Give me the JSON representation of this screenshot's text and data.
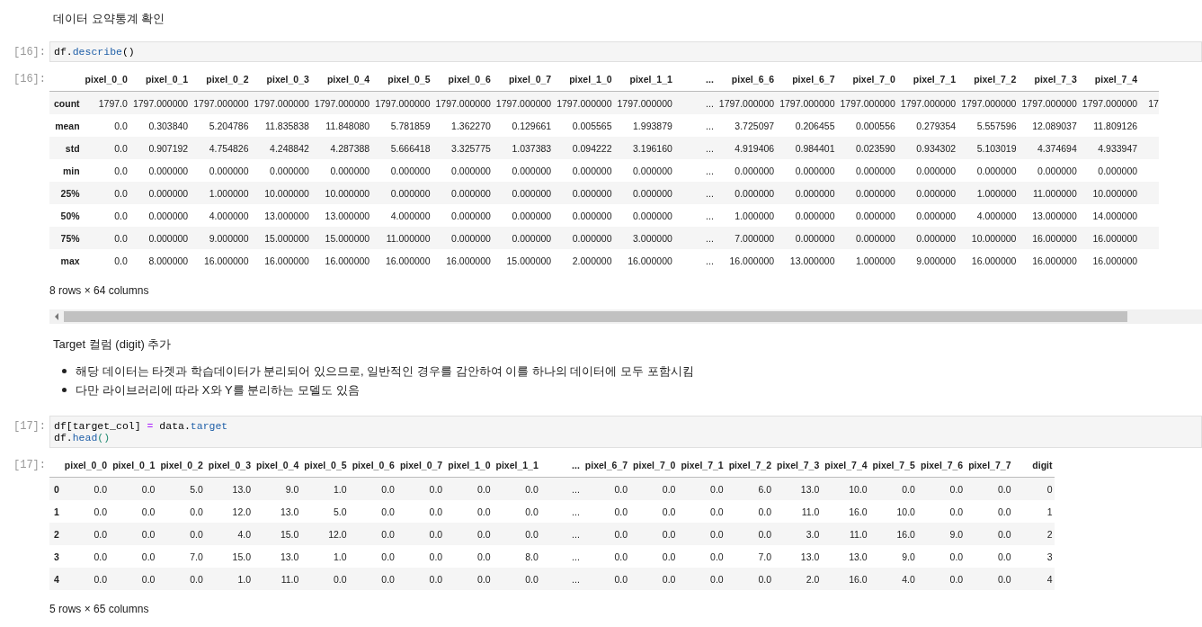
{
  "cells": [
    {
      "kind": "markdown",
      "paragraphs": [
        "데이터 요약통계 확인"
      ]
    },
    {
      "kind": "code",
      "prompt": "[16]:",
      "lines": [
        [
          {
            "text": "df.",
            "kind": "plain"
          },
          {
            "text": "describe",
            "kind": "attr"
          },
          {
            "text": "()",
            "kind": "plain"
          }
        ]
      ]
    },
    {
      "kind": "output",
      "prompt": "[16]:",
      "table": {
        "columns": [
          {
            "label": "pixel_0_0"
          },
          {
            "label": "pixel_0_1"
          },
          {
            "label": "pixel_0_2"
          },
          {
            "label": "pixel_0_3"
          },
          {
            "label": "pixel_0_4"
          },
          {
            "label": "pixel_0_5"
          },
          {
            "label": "pixel_0_6"
          },
          {
            "label": "pixel_0_7"
          },
          {
            "label": "pixel_1_0"
          },
          {
            "label": "pixel_1_1"
          },
          {
            "label": "..."
          },
          {
            "label": "pixel_6_6"
          },
          {
            "label": "pixel_6_7"
          },
          {
            "label": "pixel_7_0"
          },
          {
            "label": "pixel_7_1"
          },
          {
            "label": "pixel_7_2"
          },
          {
            "label": "pixel_7_3"
          },
          {
            "label": "pixel_7_4"
          },
          {
            "kind": "cut"
          }
        ],
        "rows": [
          {
            "index": "count",
            "cells": [
              "1797.0",
              "1797.000000",
              "1797.000000",
              "1797.000000",
              "1797.000000",
              "1797.000000",
              "1797.000000",
              "1797.000000",
              "1797.000000",
              "1797.000000",
              "...",
              "1797.000000",
              "1797.000000",
              "1797.000000",
              "1797.000000",
              "1797.000000",
              "1797.000000",
              "1797.000000",
              "17"
            ]
          },
          {
            "index": "mean",
            "cells": [
              "0.0",
              "0.303840",
              "5.204786",
              "11.835838",
              "11.848080",
              "5.781859",
              "1.362270",
              "0.129661",
              "0.005565",
              "1.993879",
              "...",
              "3.725097",
              "0.206455",
              "0.000556",
              "0.279354",
              "5.557596",
              "12.089037",
              "11.809126"
            ]
          },
          {
            "index": "std",
            "cells": [
              "0.0",
              "0.907192",
              "4.754826",
              "4.248842",
              "4.287388",
              "5.666418",
              "3.325775",
              "1.037383",
              "0.094222",
              "3.196160",
              "...",
              "4.919406",
              "0.984401",
              "0.023590",
              "0.934302",
              "5.103019",
              "4.374694",
              "4.933947"
            ]
          },
          {
            "index": "min",
            "cells": [
              "0.0",
              "0.000000",
              "0.000000",
              "0.000000",
              "0.000000",
              "0.000000",
              "0.000000",
              "0.000000",
              "0.000000",
              "0.000000",
              "...",
              "0.000000",
              "0.000000",
              "0.000000",
              "0.000000",
              "0.000000",
              "0.000000",
              "0.000000"
            ]
          },
          {
            "index": "25%",
            "cells": [
              "0.0",
              "0.000000",
              "1.000000",
              "10.000000",
              "10.000000",
              "0.000000",
              "0.000000",
              "0.000000",
              "0.000000",
              "0.000000",
              "...",
              "0.000000",
              "0.000000",
              "0.000000",
              "0.000000",
              "1.000000",
              "11.000000",
              "10.000000"
            ]
          },
          {
            "index": "50%",
            "cells": [
              "0.0",
              "0.000000",
              "4.000000",
              "13.000000",
              "13.000000",
              "4.000000",
              "0.000000",
              "0.000000",
              "0.000000",
              "0.000000",
              "...",
              "1.000000",
              "0.000000",
              "0.000000",
              "0.000000",
              "4.000000",
              "13.000000",
              "14.000000"
            ]
          },
          {
            "index": "75%",
            "cells": [
              "0.0",
              "0.000000",
              "9.000000",
              "15.000000",
              "15.000000",
              "11.000000",
              "0.000000",
              "0.000000",
              "0.000000",
              "3.000000",
              "...",
              "7.000000",
              "0.000000",
              "0.000000",
              "0.000000",
              "10.000000",
              "16.000000",
              "16.000000"
            ]
          },
          {
            "index": "max",
            "cells": [
              "0.0",
              "8.000000",
              "16.000000",
              "16.000000",
              "16.000000",
              "16.000000",
              "16.000000",
              "15.000000",
              "2.000000",
              "16.000000",
              "...",
              "16.000000",
              "13.000000",
              "1.000000",
              "9.000000",
              "16.000000",
              "16.000000",
              "16.000000"
            ]
          }
        ]
      },
      "footer": "8 rows × 64 columns",
      "scrollbar": true
    },
    {
      "kind": "markdown",
      "paragraphs": [
        "Target 컬럼 (digit) 추가"
      ],
      "bullets": [
        "해당 데이터는 타겟과 학습데이터가 분리되어 있으므로, 일반적인 경우를 감안하여 이를 하나의 데이터에 모두 포함시킴",
        "다만 라이브러리에 따라 X와 Y를 분리하는 모델도 있음"
      ]
    },
    {
      "kind": "code",
      "prompt": "[17]:",
      "lines": [
        [
          {
            "text": "df[target_col] ",
            "kind": "plain"
          },
          {
            "text": "=",
            "kind": "op"
          },
          {
            "text": " data.",
            "kind": "plain"
          },
          {
            "text": "target",
            "kind": "attr"
          }
        ],
        [
          {
            "text": "df.",
            "kind": "plain"
          },
          {
            "text": "head",
            "kind": "attr"
          },
          {
            "text": "()",
            "kind": "paren"
          }
        ]
      ]
    },
    {
      "kind": "output",
      "prompt": "[17]:",
      "table": {
        "columns": [
          {
            "label": "pixel_0_0"
          },
          {
            "label": "pixel_0_1"
          },
          {
            "label": "pixel_0_2"
          },
          {
            "label": "pixel_0_3"
          },
          {
            "label": "pixel_0_4"
          },
          {
            "label": "pixel_0_5"
          },
          {
            "label": "pixel_0_6"
          },
          {
            "label": "pixel_0_7"
          },
          {
            "label": "pixel_1_0"
          },
          {
            "label": "pixel_1_1"
          },
          {
            "label": "..."
          },
          {
            "label": "pixel_6_7"
          },
          {
            "label": "pixel_7_0"
          },
          {
            "label": "pixel_7_1"
          },
          {
            "label": "pixel_7_2"
          },
          {
            "label": "pixel_7_3"
          },
          {
            "label": "pixel_7_4"
          },
          {
            "label": "pixel_7_5"
          },
          {
            "label": "pixel_7_6"
          },
          {
            "label": "pixel_7_7"
          },
          {
            "label": "digit"
          }
        ],
        "rows": [
          {
            "index": "0",
            "cells": [
              "0.0",
              "0.0",
              "5.0",
              "13.0",
              "9.0",
              "1.0",
              "0.0",
              "0.0",
              "0.0",
              "0.0",
              "...",
              "0.0",
              "0.0",
              "0.0",
              "6.0",
              "13.0",
              "10.0",
              "0.0",
              "0.0",
              "0.0",
              "0"
            ]
          },
          {
            "index": "1",
            "cells": [
              "0.0",
              "0.0",
              "0.0",
              "12.0",
              "13.0",
              "5.0",
              "0.0",
              "0.0",
              "0.0",
              "0.0",
              "...",
              "0.0",
              "0.0",
              "0.0",
              "0.0",
              "11.0",
              "16.0",
              "10.0",
              "0.0",
              "0.0",
              "1"
            ]
          },
          {
            "index": "2",
            "cells": [
              "0.0",
              "0.0",
              "0.0",
              "4.0",
              "15.0",
              "12.0",
              "0.0",
              "0.0",
              "0.0",
              "0.0",
              "...",
              "0.0",
              "0.0",
              "0.0",
              "0.0",
              "3.0",
              "11.0",
              "16.0",
              "9.0",
              "0.0",
              "2"
            ]
          },
          {
            "index": "3",
            "cells": [
              "0.0",
              "0.0",
              "7.0",
              "15.0",
              "13.0",
              "1.0",
              "0.0",
              "0.0",
              "0.0",
              "8.0",
              "...",
              "0.0",
              "0.0",
              "0.0",
              "7.0",
              "13.0",
              "13.0",
              "9.0",
              "0.0",
              "0.0",
              "3"
            ]
          },
          {
            "index": "4",
            "cells": [
              "0.0",
              "0.0",
              "0.0",
              "1.0",
              "11.0",
              "0.0",
              "0.0",
              "0.0",
              "0.0",
              "0.0",
              "...",
              "0.0",
              "0.0",
              "0.0",
              "0.0",
              "2.0",
              "16.0",
              "4.0",
              "0.0",
              "0.0",
              "4"
            ]
          }
        ]
      },
      "footer": "5 rows × 65 columns",
      "scrollbar": false
    }
  ]
}
